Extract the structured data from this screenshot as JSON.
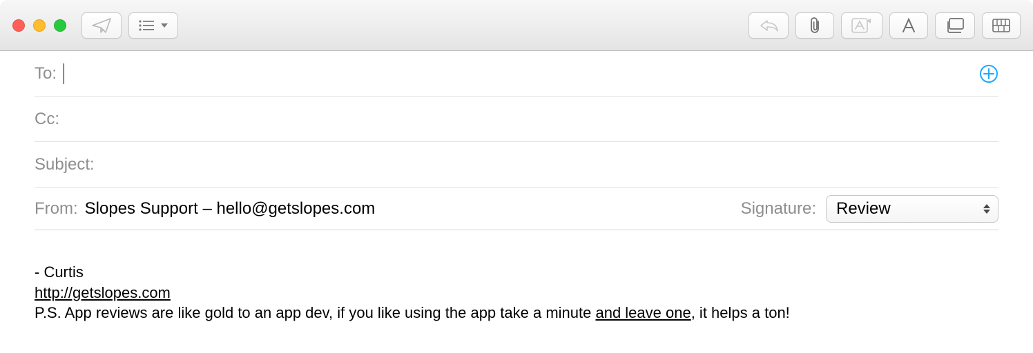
{
  "fields": {
    "to_label": "To:",
    "cc_label": "Cc:",
    "subject_label": "Subject:",
    "from_label": "From:",
    "from_value": "Slopes Support – hello@getslopes.com",
    "signature_label": "Signature:",
    "signature_selected": "Review"
  },
  "body": {
    "signoff": "- Curtis",
    "url_text": "http://getslopes.com",
    "ps_prefix": "P.S. App reviews are like gold to an app dev, if you like using the app take a minute ",
    "ps_link": "and leave one",
    "ps_suffix": ", it helps a ton!"
  }
}
